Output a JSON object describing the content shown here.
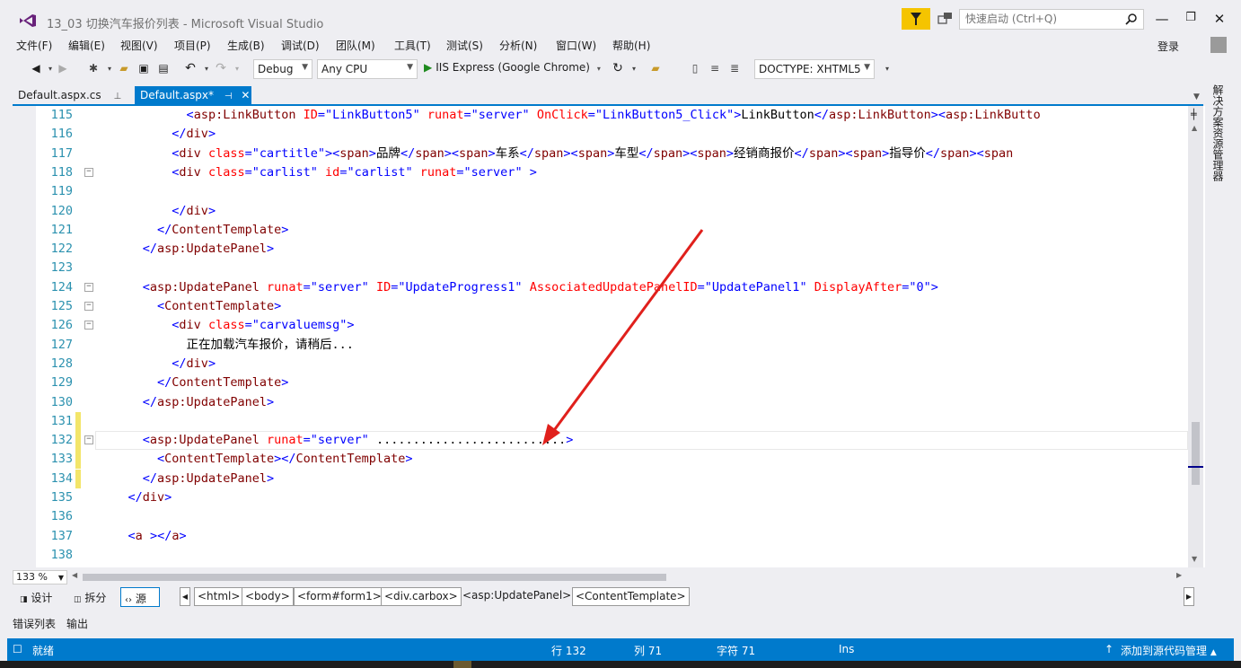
{
  "window": {
    "title": "13_03 切换汽车报价列表 - Microsoft Visual Studio",
    "quick_launch_placeholder": "快速启动 (Ctrl+Q)"
  },
  "menu": [
    "文件(F)",
    "编辑(E)",
    "视图(V)",
    "项目(P)",
    "生成(B)",
    "调试(D)",
    "团队(M)",
    "工具(T)",
    "测试(S)",
    "分析(N)",
    "窗口(W)",
    "帮助(H)"
  ],
  "signin": "登录",
  "toolbar": {
    "config": "Debug",
    "platform": "Any CPU",
    "run_target": "IIS Express (Google Chrome)",
    "doctype": "DOCTYPE: XHTML5"
  },
  "tabs": {
    "inactive": "Default.aspx.cs",
    "active": "Default.aspx*"
  },
  "side_panel": "解决方案资源管理器",
  "editor": {
    "lines": [
      {
        "n": "115",
        "parts": [
          [
            "s",
            "            "
          ],
          [
            "br",
            "<"
          ],
          [
            "tag",
            "asp:LinkButton"
          ],
          [
            "s",
            " "
          ],
          [
            "attr",
            "ID"
          ],
          [
            "br",
            "=\""
          ],
          [
            "val",
            "LinkButton5"
          ],
          [
            "br",
            "\""
          ],
          [
            "s",
            " "
          ],
          [
            "attr",
            "runat"
          ],
          [
            "br",
            "=\""
          ],
          [
            "val",
            "server"
          ],
          [
            "br",
            "\""
          ],
          [
            "s",
            " "
          ],
          [
            "attr",
            "OnClick"
          ],
          [
            "br",
            "=\""
          ],
          [
            "val",
            "LinkButton5_Click"
          ],
          [
            "br",
            "\">"
          ],
          [
            "text",
            "LinkButton"
          ],
          [
            "br",
            "</"
          ],
          [
            "tag",
            "asp:LinkButton"
          ],
          [
            "br",
            "><"
          ],
          [
            "tag",
            "asp:LinkButto"
          ]
        ]
      },
      {
        "n": "116",
        "parts": [
          [
            "s",
            "          "
          ],
          [
            "br",
            "</"
          ],
          [
            "tag",
            "div"
          ],
          [
            "br",
            ">"
          ]
        ]
      },
      {
        "n": "117",
        "parts": [
          [
            "s",
            "          "
          ],
          [
            "br",
            "<"
          ],
          [
            "tag",
            "div"
          ],
          [
            "s",
            " "
          ],
          [
            "attr",
            "class"
          ],
          [
            "br",
            "=\""
          ],
          [
            "val",
            "cartitle"
          ],
          [
            "br",
            "\"><"
          ],
          [
            "tag",
            "span"
          ],
          [
            "br",
            ">"
          ],
          [
            "text",
            "品牌"
          ],
          [
            "br",
            "</"
          ],
          [
            "tag",
            "span"
          ],
          [
            "br",
            "><"
          ],
          [
            "tag",
            "span"
          ],
          [
            "br",
            ">"
          ],
          [
            "text",
            "车系"
          ],
          [
            "br",
            "</"
          ],
          [
            "tag",
            "span"
          ],
          [
            "br",
            "><"
          ],
          [
            "tag",
            "span"
          ],
          [
            "br",
            ">"
          ],
          [
            "text",
            "车型"
          ],
          [
            "br",
            "</"
          ],
          [
            "tag",
            "span"
          ],
          [
            "br",
            "><"
          ],
          [
            "tag",
            "span"
          ],
          [
            "br",
            ">"
          ],
          [
            "text",
            "经销商报价"
          ],
          [
            "br",
            "</"
          ],
          [
            "tag",
            "span"
          ],
          [
            "br",
            "><"
          ],
          [
            "tag",
            "span"
          ],
          [
            "br",
            ">"
          ],
          [
            "text",
            "指导价"
          ],
          [
            "br",
            "</"
          ],
          [
            "tag",
            "span"
          ],
          [
            "br",
            "><"
          ],
          [
            "tag",
            "span"
          ]
        ]
      },
      {
        "n": "118",
        "fold": "−",
        "parts": [
          [
            "s",
            "          "
          ],
          [
            "br",
            "<"
          ],
          [
            "tag",
            "div"
          ],
          [
            "s",
            " "
          ],
          [
            "attr",
            "class"
          ],
          [
            "br",
            "=\""
          ],
          [
            "val",
            "carlist"
          ],
          [
            "br",
            "\""
          ],
          [
            "s",
            " "
          ],
          [
            "attr",
            "id"
          ],
          [
            "br",
            "=\""
          ],
          [
            "val",
            "carlist"
          ],
          [
            "br",
            "\""
          ],
          [
            "s",
            " "
          ],
          [
            "attr",
            "runat"
          ],
          [
            "br",
            "=\""
          ],
          [
            "val",
            "server"
          ],
          [
            "br",
            "\""
          ],
          [
            "s",
            " "
          ],
          [
            "br",
            ">"
          ]
        ]
      },
      {
        "n": "119",
        "parts": []
      },
      {
        "n": "120",
        "parts": [
          [
            "s",
            "          "
          ],
          [
            "br",
            "</"
          ],
          [
            "tag",
            "div"
          ],
          [
            "br",
            ">"
          ]
        ]
      },
      {
        "n": "121",
        "parts": [
          [
            "s",
            "        "
          ],
          [
            "br",
            "</"
          ],
          [
            "tag",
            "ContentTemplate"
          ],
          [
            "br",
            ">"
          ]
        ]
      },
      {
        "n": "122",
        "parts": [
          [
            "s",
            "      "
          ],
          [
            "br",
            "</"
          ],
          [
            "tag",
            "asp:UpdatePanel"
          ],
          [
            "br",
            ">"
          ]
        ]
      },
      {
        "n": "123",
        "parts": []
      },
      {
        "n": "124",
        "fold": "−",
        "parts": [
          [
            "s",
            "      "
          ],
          [
            "br",
            "<"
          ],
          [
            "tag",
            "asp:UpdatePanel"
          ],
          [
            "s",
            " "
          ],
          [
            "attr",
            "runat"
          ],
          [
            "br",
            "=\""
          ],
          [
            "val",
            "server"
          ],
          [
            "br",
            "\""
          ],
          [
            "s",
            " "
          ],
          [
            "attr",
            "ID"
          ],
          [
            "br",
            "=\""
          ],
          [
            "val",
            "UpdateProgress1"
          ],
          [
            "br",
            "\""
          ],
          [
            "s",
            " "
          ],
          [
            "attr",
            "AssociatedUpdatePanelID"
          ],
          [
            "br",
            "=\""
          ],
          [
            "val",
            "UpdatePanel1"
          ],
          [
            "br",
            "\""
          ],
          [
            "s",
            " "
          ],
          [
            "attr",
            "DisplayAfter"
          ],
          [
            "br",
            "=\""
          ],
          [
            "val",
            "0"
          ],
          [
            "br",
            "\">"
          ]
        ]
      },
      {
        "n": "125",
        "fold": "−",
        "parts": [
          [
            "s",
            "        "
          ],
          [
            "br",
            "<"
          ],
          [
            "tag",
            "ContentTemplate"
          ],
          [
            "br",
            ">"
          ]
        ]
      },
      {
        "n": "126",
        "fold": "−",
        "parts": [
          [
            "s",
            "          "
          ],
          [
            "br",
            "<"
          ],
          [
            "tag",
            "div"
          ],
          [
            "s",
            " "
          ],
          [
            "attr",
            "class"
          ],
          [
            "br",
            "=\""
          ],
          [
            "val",
            "carvaluemsg"
          ],
          [
            "br",
            "\">"
          ]
        ]
      },
      {
        "n": "127",
        "parts": [
          [
            "s",
            "            "
          ],
          [
            "text",
            "正在加载汽车报价，请稍后..."
          ]
        ]
      },
      {
        "n": "128",
        "parts": [
          [
            "s",
            "          "
          ],
          [
            "br",
            "</"
          ],
          [
            "tag",
            "div"
          ],
          [
            "br",
            ">"
          ]
        ]
      },
      {
        "n": "129",
        "parts": [
          [
            "s",
            "        "
          ],
          [
            "br",
            "</"
          ],
          [
            "tag",
            "ContentTemplate"
          ],
          [
            "br",
            ">"
          ]
        ]
      },
      {
        "n": "130",
        "parts": [
          [
            "s",
            "      "
          ],
          [
            "br",
            "</"
          ],
          [
            "tag",
            "asp:UpdatePanel"
          ],
          [
            "br",
            ">"
          ]
        ]
      },
      {
        "n": "131",
        "changed": true,
        "parts": []
      },
      {
        "n": "132",
        "changed": true,
        "current": true,
        "fold": "−",
        "parts": [
          [
            "s",
            "      "
          ],
          [
            "br",
            "<"
          ],
          [
            "tag",
            "asp:UpdatePanel"
          ],
          [
            "s",
            " "
          ],
          [
            "attr",
            "runat"
          ],
          [
            "br",
            "=\""
          ],
          [
            "val",
            "server"
          ],
          [
            "br",
            "\""
          ],
          [
            "s",
            " "
          ],
          [
            "text",
            ".........................."
          ],
          [
            "br",
            ">"
          ]
        ]
      },
      {
        "n": "133",
        "changed": true,
        "parts": [
          [
            "s",
            "        "
          ],
          [
            "br",
            "<"
          ],
          [
            "tag",
            "ContentTemplate"
          ],
          [
            "br",
            "></"
          ],
          [
            "tag",
            "ContentTemplate"
          ],
          [
            "br",
            ">"
          ]
        ]
      },
      {
        "n": "134",
        "changed": true,
        "parts": [
          [
            "s",
            "      "
          ],
          [
            "br",
            "</"
          ],
          [
            "tag",
            "asp:UpdatePanel"
          ],
          [
            "br",
            ">"
          ]
        ]
      },
      {
        "n": "135",
        "parts": [
          [
            "s",
            "    "
          ],
          [
            "br",
            "</"
          ],
          [
            "tag",
            "div"
          ],
          [
            "br",
            ">"
          ]
        ]
      },
      {
        "n": "136",
        "parts": []
      },
      {
        "n": "137",
        "parts": [
          [
            "s",
            "    "
          ],
          [
            "br",
            "<"
          ],
          [
            "tag",
            "a"
          ],
          [
            "s",
            " "
          ],
          [
            "br",
            "></"
          ],
          [
            "tag",
            "a"
          ],
          [
            "br",
            ">"
          ]
        ]
      },
      {
        "n": "138",
        "parts": []
      }
    ]
  },
  "zoom": "133 %",
  "views": {
    "design": "设计",
    "split": "拆分",
    "source": "源"
  },
  "breadcrumbs": [
    "<html>",
    "<body>",
    "<form#form1>",
    "<div.carbox>",
    "<asp:UpdatePanel>",
    "<ContentTemplate>"
  ],
  "output_tabs": [
    "错误列表",
    "输出"
  ],
  "status": {
    "ready": "就绪",
    "row": "行 132",
    "col": "列 71",
    "char": "字符 71",
    "mode": "Ins",
    "source_control": "添加到源代码管理"
  },
  "colors": {
    "accent": "#007acc",
    "tag": "#800000",
    "bracket": "#0000ff",
    "attribute": "#ff0000",
    "value": "#0000ff",
    "line_number": "#2b91af",
    "change_marker": "#f3e56a",
    "annotation_arrow": "#e0201c"
  }
}
